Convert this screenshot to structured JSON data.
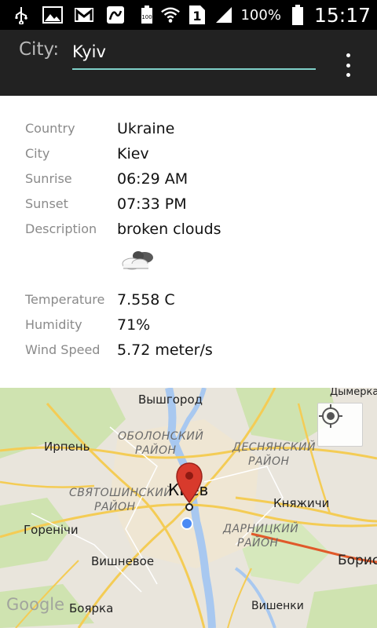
{
  "status_bar": {
    "battery_pct": "100%",
    "time": "15:17",
    "sim_slot": "1",
    "icons": [
      "usb-icon",
      "image-icon",
      "gmail-icon",
      "app-icon",
      "battery-small-icon",
      "wifi-icon",
      "sim-icon",
      "signal-icon",
      "battery-icon"
    ]
  },
  "action_bar": {
    "city_label": "City:",
    "city_value": "Kyiv",
    "underline_color": "#7fd1c9",
    "menu_icon": "overflow-menu-icon"
  },
  "info": {
    "rows": [
      {
        "label": "Country",
        "value": "Ukraine"
      },
      {
        "label": "City",
        "value": "Kiev"
      },
      {
        "label": "Sunrise",
        "value": "06:29 AM"
      },
      {
        "label": "Sunset",
        "value": "07:33 PM"
      },
      {
        "label": "Description",
        "value": "broken clouds"
      }
    ],
    "weather_icon": "broken-clouds-icon",
    "rows2": [
      {
        "label": "Temperature",
        "value": "7.558 C"
      },
      {
        "label": "Humidity",
        "value": "71%"
      },
      {
        "label": "Wind Speed",
        "value": "5.72 meter/s"
      }
    ]
  },
  "map": {
    "labels": {
      "vyshhorod": "Вышгород",
      "dymerka": "Дымерка",
      "obolon1": "ОБОЛОНСКИЙ",
      "obolon2": "РАЙОН",
      "irpin": "Ирпень",
      "desnyan1": "ДЕСНЯНСКИЙ",
      "desnyan2": "РАЙОН",
      "svyato1": "СВЯТОШИНСКИЙ",
      "svyato2": "РАЙОН",
      "kiev": "Киев",
      "knyazhichi": "Княжичи",
      "gorenichi": "Горенічи",
      "darnytsia1": "ДАРНИЦКИЙ",
      "darnytsia2": "РАЙОН",
      "vyshneve": "Вишневое",
      "borys": "Борис",
      "boyarka": "Боярка",
      "vyshenky": "Вишенки",
      "google": "Google"
    },
    "my_location_icon": "my-location-icon",
    "marker_icon": "map-pin-icon",
    "accent": "#d83a2c",
    "location_dot": "#4a8af4"
  }
}
